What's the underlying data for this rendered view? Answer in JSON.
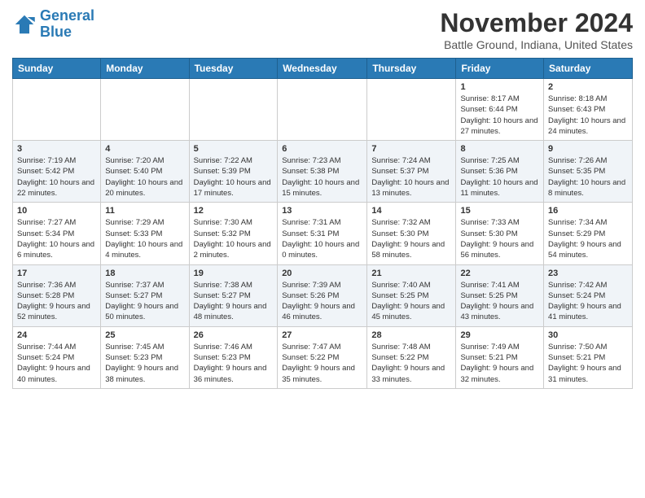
{
  "logo": {
    "line1": "General",
    "line2": "Blue"
  },
  "title": "November 2024",
  "location": "Battle Ground, Indiana, United States",
  "days_of_week": [
    "Sunday",
    "Monday",
    "Tuesday",
    "Wednesday",
    "Thursday",
    "Friday",
    "Saturday"
  ],
  "weeks": [
    [
      {
        "day": "",
        "info": ""
      },
      {
        "day": "",
        "info": ""
      },
      {
        "day": "",
        "info": ""
      },
      {
        "day": "",
        "info": ""
      },
      {
        "day": "",
        "info": ""
      },
      {
        "day": "1",
        "info": "Sunrise: 8:17 AM\nSunset: 6:44 PM\nDaylight: 10 hours and 27 minutes."
      },
      {
        "day": "2",
        "info": "Sunrise: 8:18 AM\nSunset: 6:43 PM\nDaylight: 10 hours and 24 minutes."
      }
    ],
    [
      {
        "day": "3",
        "info": "Sunrise: 7:19 AM\nSunset: 5:42 PM\nDaylight: 10 hours and 22 minutes."
      },
      {
        "day": "4",
        "info": "Sunrise: 7:20 AM\nSunset: 5:40 PM\nDaylight: 10 hours and 20 minutes."
      },
      {
        "day": "5",
        "info": "Sunrise: 7:22 AM\nSunset: 5:39 PM\nDaylight: 10 hours and 17 minutes."
      },
      {
        "day": "6",
        "info": "Sunrise: 7:23 AM\nSunset: 5:38 PM\nDaylight: 10 hours and 15 minutes."
      },
      {
        "day": "7",
        "info": "Sunrise: 7:24 AM\nSunset: 5:37 PM\nDaylight: 10 hours and 13 minutes."
      },
      {
        "day": "8",
        "info": "Sunrise: 7:25 AM\nSunset: 5:36 PM\nDaylight: 10 hours and 11 minutes."
      },
      {
        "day": "9",
        "info": "Sunrise: 7:26 AM\nSunset: 5:35 PM\nDaylight: 10 hours and 8 minutes."
      }
    ],
    [
      {
        "day": "10",
        "info": "Sunrise: 7:27 AM\nSunset: 5:34 PM\nDaylight: 10 hours and 6 minutes."
      },
      {
        "day": "11",
        "info": "Sunrise: 7:29 AM\nSunset: 5:33 PM\nDaylight: 10 hours and 4 minutes."
      },
      {
        "day": "12",
        "info": "Sunrise: 7:30 AM\nSunset: 5:32 PM\nDaylight: 10 hours and 2 minutes."
      },
      {
        "day": "13",
        "info": "Sunrise: 7:31 AM\nSunset: 5:31 PM\nDaylight: 10 hours and 0 minutes."
      },
      {
        "day": "14",
        "info": "Sunrise: 7:32 AM\nSunset: 5:30 PM\nDaylight: 9 hours and 58 minutes."
      },
      {
        "day": "15",
        "info": "Sunrise: 7:33 AM\nSunset: 5:30 PM\nDaylight: 9 hours and 56 minutes."
      },
      {
        "day": "16",
        "info": "Sunrise: 7:34 AM\nSunset: 5:29 PM\nDaylight: 9 hours and 54 minutes."
      }
    ],
    [
      {
        "day": "17",
        "info": "Sunrise: 7:36 AM\nSunset: 5:28 PM\nDaylight: 9 hours and 52 minutes."
      },
      {
        "day": "18",
        "info": "Sunrise: 7:37 AM\nSunset: 5:27 PM\nDaylight: 9 hours and 50 minutes."
      },
      {
        "day": "19",
        "info": "Sunrise: 7:38 AM\nSunset: 5:27 PM\nDaylight: 9 hours and 48 minutes."
      },
      {
        "day": "20",
        "info": "Sunrise: 7:39 AM\nSunset: 5:26 PM\nDaylight: 9 hours and 46 minutes."
      },
      {
        "day": "21",
        "info": "Sunrise: 7:40 AM\nSunset: 5:25 PM\nDaylight: 9 hours and 45 minutes."
      },
      {
        "day": "22",
        "info": "Sunrise: 7:41 AM\nSunset: 5:25 PM\nDaylight: 9 hours and 43 minutes."
      },
      {
        "day": "23",
        "info": "Sunrise: 7:42 AM\nSunset: 5:24 PM\nDaylight: 9 hours and 41 minutes."
      }
    ],
    [
      {
        "day": "24",
        "info": "Sunrise: 7:44 AM\nSunset: 5:24 PM\nDaylight: 9 hours and 40 minutes."
      },
      {
        "day": "25",
        "info": "Sunrise: 7:45 AM\nSunset: 5:23 PM\nDaylight: 9 hours and 38 minutes."
      },
      {
        "day": "26",
        "info": "Sunrise: 7:46 AM\nSunset: 5:23 PM\nDaylight: 9 hours and 36 minutes."
      },
      {
        "day": "27",
        "info": "Sunrise: 7:47 AM\nSunset: 5:22 PM\nDaylight: 9 hours and 35 minutes."
      },
      {
        "day": "28",
        "info": "Sunrise: 7:48 AM\nSunset: 5:22 PM\nDaylight: 9 hours and 33 minutes."
      },
      {
        "day": "29",
        "info": "Sunrise: 7:49 AM\nSunset: 5:21 PM\nDaylight: 9 hours and 32 minutes."
      },
      {
        "day": "30",
        "info": "Sunrise: 7:50 AM\nSunset: 5:21 PM\nDaylight: 9 hours and 31 minutes."
      }
    ]
  ]
}
